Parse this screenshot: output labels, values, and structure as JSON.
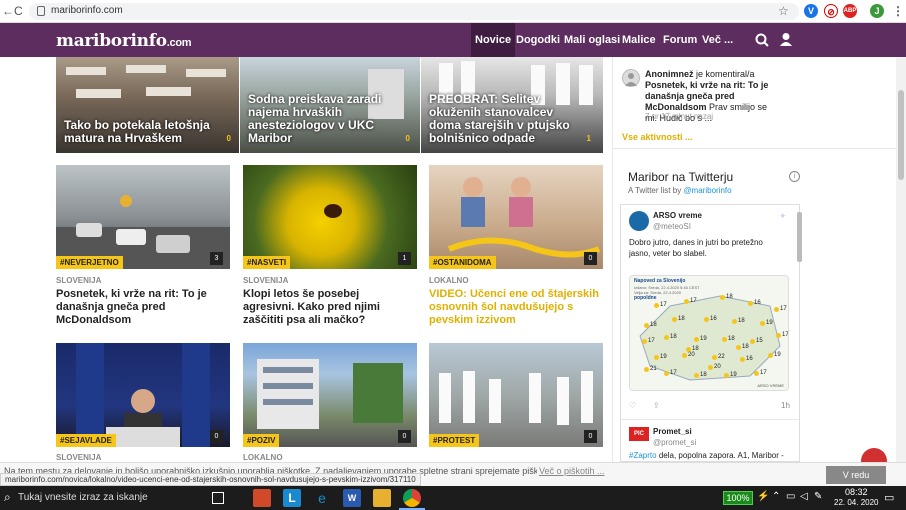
{
  "browser": {
    "url": "mariborinfo.com",
    "nav_back": "←",
    "nav_forward": "→",
    "nav_reload": "C",
    "star": "☆",
    "extensions": [
      "V",
      "⊘",
      "ABP",
      "J"
    ],
    "menu_dots": "⋮",
    "accent": "#5c2d5e"
  },
  "site": {
    "logo": "mariborinfo",
    "logo_suffix": ".com",
    "menu": [
      {
        "label": "Novice",
        "active": true
      },
      {
        "label": "Dogodki"
      },
      {
        "label": "Mali oglasi"
      },
      {
        "label": "Malice"
      },
      {
        "label": "Forum"
      },
      {
        "label": "Več ..."
      }
    ],
    "search_icon": "search-icon",
    "user_icon": "user-icon"
  },
  "top_row": [
    {
      "title": "Tako bo potekala letošnja matura na Hrvaškem",
      "count": "0"
    },
    {
      "title": "Sodna preiskava zaradi najema hrvaških anesteziologov v UKC Maribor",
      "count": "0"
    },
    {
      "title": "PREOBRAT: Selitev okuženih stanovalcev doma starejših v ptujsko bolnišnico odpade",
      "count": "1"
    }
  ],
  "mid_row": [
    {
      "tag": "#NEVERJETNO",
      "count": "3",
      "category": "SLOVENIJA",
      "title": "Posnetek, ki vrže na rit: To je današnja gneča pred McDonaldsom",
      "highlight": false
    },
    {
      "tag": "#NASVETI",
      "count": "1",
      "category": "SLOVENIJA",
      "title": "Klopi letos še posebej agresivni. Kako pred njimi zaščititi psa ali mačko?",
      "highlight": false
    },
    {
      "tag": "#OSTANIDOMA",
      "count": "0",
      "category": "LOKALNO",
      "title": "VIDEO: Učenci ene od štajerskih osnovnih šol navdušujejo s pevskim izzivom",
      "highlight": true
    }
  ],
  "bottom_row": [
    {
      "tag": "#SEJAVLADE",
      "count": "0",
      "category": "SLOVENIJA"
    },
    {
      "tag": "#POZIV",
      "count": "0",
      "category": "LOKALNO"
    },
    {
      "tag": "#PROTEST",
      "count": "0",
      "category": ""
    }
  ],
  "sidebar": {
    "comment_user": "Anonimnež",
    "comment_action": "je komentiral/a",
    "comment_article": "Posnetek, ki vrže na rit: To je današnja gneča pred McDonaldsom",
    "comment_text": "Prav smilijo se mi. Hudič bo š ...",
    "comment_time": "7 ur 17 minut nazaj",
    "all_activity": "Vse aktivnosti ...",
    "twitter_title": "Maribor na Twitterju",
    "twitter_sub_prefix": "A Twitter list by",
    "twitter_list_owner": "@mariborinfo",
    "tweet1_name": "ARSO vreme",
    "tweet1_handle": "@meteoSI",
    "tweet1_text": "Dobro jutro, danes in jutri bo pretežno jasno, veter bo slabel.",
    "map_title": "Napoved za Slovenijo",
    "map_line1": "Izdano: Sreda, 22.4.2020 5:46 CEST",
    "map_line2": "Velja za: Sreda, 22.4.2020",
    "map_line3": "popoldne",
    "map_brand": "ARSO VREME",
    "map_temps": [
      "17",
      "17",
      "18",
      "16",
      "17",
      "18",
      "18",
      "16",
      "18",
      "19",
      "17",
      "18",
      "19",
      "18",
      "15",
      "17",
      "19",
      "20",
      "22",
      "16",
      "19",
      "17",
      "18",
      "19",
      "17",
      "21",
      "20",
      "18",
      "18"
    ],
    "tweet1_time": "1h",
    "tweet2_name": "Promet_si",
    "tweet2_handle": "@promet_si",
    "tweet2_hashtag": "#Zaprto",
    "tweet2_text": "dela, popolna zapora. A1, Maribor -"
  },
  "cookie": {
    "text": "Na tem mestu za delovanje in boljšo uporabniško izkušnjo uporablja piškotke. Z nadaljevanjem uporabe spletne strani sprejemate piškotke.",
    "link": "Več o piškotih ...",
    "button": "V redu"
  },
  "status_url": "mariborinfo.com/novica/lokalno/video-ucenci-ene-od-stajerskih-osnovnih-sol-navdusujejo-s-pevskim-izzivom/317110",
  "taskbar": {
    "search_placeholder": "Tukaj vnesite izraz za iskanje",
    "battery": "100%",
    "time": "08:32",
    "date": "22. 04. 2020"
  }
}
